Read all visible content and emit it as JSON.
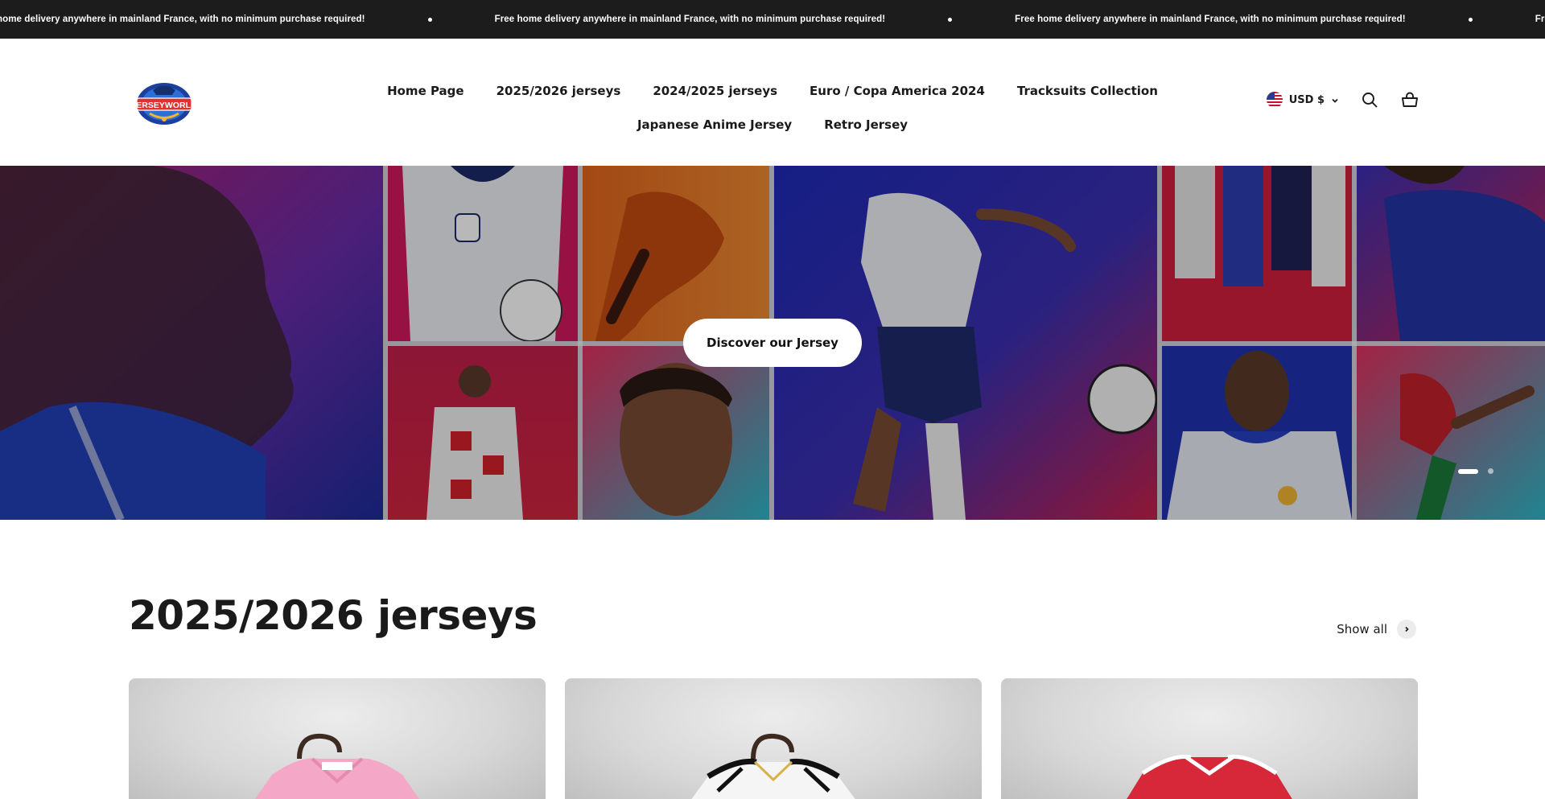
{
  "announcement": {
    "items": [
      "Free home delivery anywhere in mainland France, with no minimum purchase required!",
      "Free home delivery anywhere in mainland France, with no minimum purchase required!",
      "Free home delivery anywhere in mainland France, with no minimum purchase required!",
      "Free home delivery anywhere in mainland France, with no minimum purchase required!"
    ]
  },
  "header": {
    "logo_text": "JERSEYWORLD",
    "nav": {
      "row1": [
        "Home Page",
        "2025/2026 jerseys",
        "2024/2025 jerseys",
        "Euro / Copa America 2024",
        "Tracksuits Collection"
      ],
      "row2": [
        "Japanese Anime Jersey",
        "Retro Jersey"
      ]
    },
    "currency": "USD $",
    "icons": [
      "us-flag-icon",
      "chevron-down-icon",
      "search-icon",
      "cart-icon"
    ]
  },
  "hero": {
    "button_label": "Discover our Jersey",
    "slide_count": 2,
    "active_slide": 1
  },
  "section": {
    "title": "2025/2026 jerseys",
    "show_all_label": "Show all",
    "products": [
      {
        "jersey_color": "#f4a7c7"
      },
      {
        "jersey_color": "#f5f5f5"
      },
      {
        "jersey_color": "#d62839"
      }
    ]
  },
  "colors": {
    "announcement_bg": "#1c1c1c",
    "text": "#1a1a1a",
    "hero_blue": "#1f2a8f",
    "hero_red": "#d61f3c"
  }
}
